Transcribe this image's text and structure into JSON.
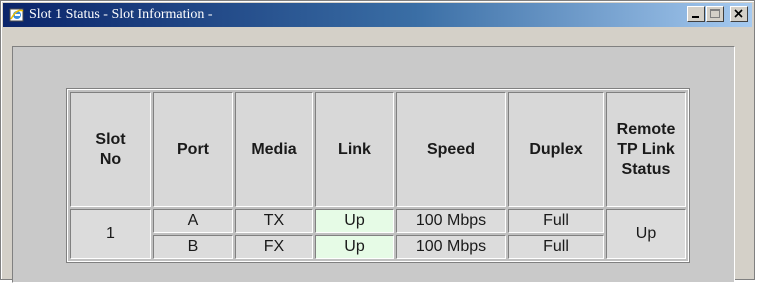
{
  "window": {
    "title": "Slot 1 Status - Slot Information -",
    "icon": "internet-explorer-icon",
    "controls": {
      "minimize": "minimize-icon",
      "maximize": "maximize-icon",
      "close": "close-icon"
    }
  },
  "table": {
    "headers": {
      "slot_no": "Slot No",
      "port": "Port",
      "media": "Media",
      "link": "Link",
      "speed": "Speed",
      "duplex": "Duplex",
      "remote": "Remote TP Link Status"
    },
    "slot": "1",
    "remote_status": "Up",
    "rows": [
      {
        "port": "A",
        "media": "TX",
        "link": "Up",
        "speed": "100 Mbps",
        "duplex": "Full"
      },
      {
        "port": "B",
        "media": "FX",
        "link": "Up",
        "speed": "100 Mbps",
        "duplex": "Full"
      }
    ]
  },
  "colors": {
    "titlebar_start": "#0a246a",
    "titlebar_end": "#a6caf0",
    "link_up_bg": "#e6fbe6"
  }
}
